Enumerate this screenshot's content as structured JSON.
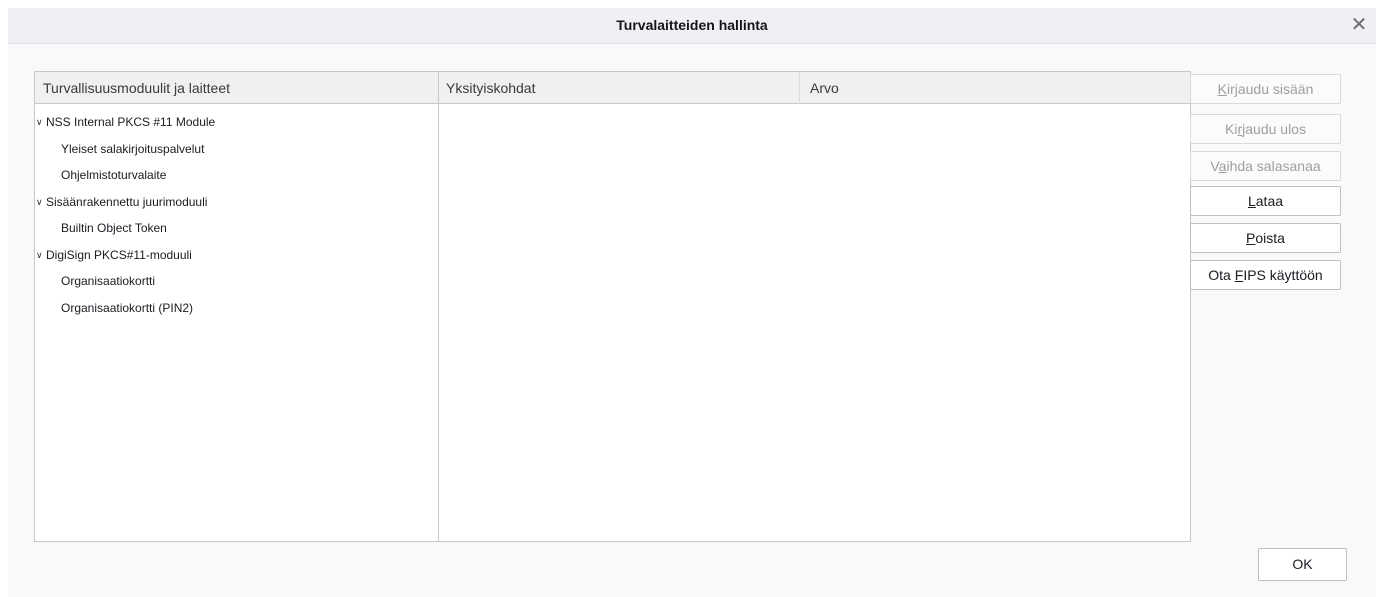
{
  "window": {
    "title": "Turvalaitteiden hallinta",
    "close_symbol": "✕"
  },
  "tree": {
    "header": "Turvallisuusmoduulit ja laitteet",
    "expanded_symbol": "∨",
    "modules": [
      {
        "label": "NSS Internal PKCS #11 Module",
        "devices": [
          "Yleiset salakirjoituspalvelut",
          "Ohjelmistoturvalaite"
        ]
      },
      {
        "label": "Sisäänrakennettu juurimoduuli",
        "devices": [
          "Builtin Object Token"
        ]
      },
      {
        "label": "DigiSign PKCS#11-moduuli",
        "devices": [
          "Organisaatiokortti",
          "Organisaatiokortti (PIN2)"
        ]
      }
    ]
  },
  "details": {
    "col_details": "Yksityiskohdat",
    "col_value": "Arvo"
  },
  "buttons": {
    "login": {
      "pre": "",
      "key": "K",
      "post": "irjaudu sisään",
      "enabled": false
    },
    "logout": {
      "pre": "Ki",
      "key": "r",
      "post": "jaudu ulos",
      "enabled": false
    },
    "change_password": {
      "pre": "V",
      "key": "a",
      "post": "ihda salasanaa",
      "enabled": false
    },
    "load": {
      "pre": "",
      "key": "L",
      "post": "ataa",
      "enabled": true
    },
    "unload": {
      "pre": "",
      "key": "P",
      "post": "oista",
      "enabled": true
    },
    "fips": {
      "pre": "Ota ",
      "key": "F",
      "post": "IPS käyttöön",
      "enabled": true
    },
    "ok": "OK"
  }
}
